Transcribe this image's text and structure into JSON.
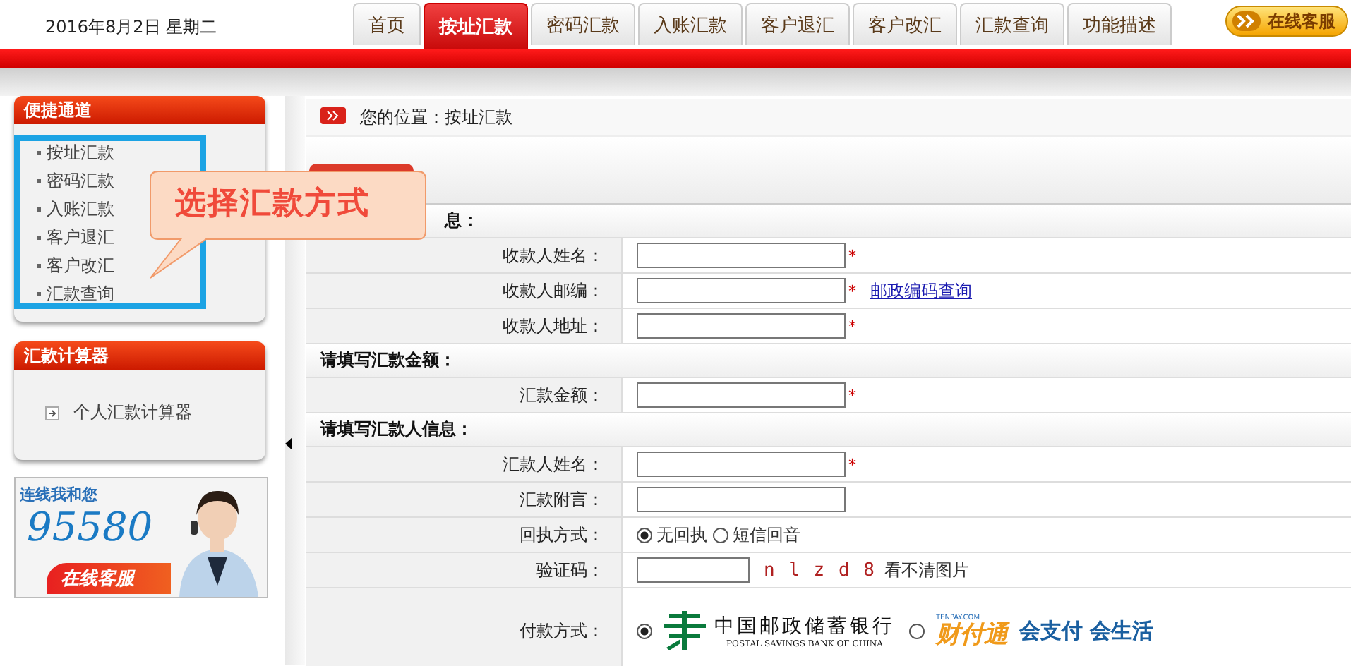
{
  "header": {
    "date": "2016年8月2日 星期二",
    "online_service": "在线客服"
  },
  "tabs": [
    {
      "label": "首页",
      "selected": false
    },
    {
      "label": "按址汇款",
      "selected": true
    },
    {
      "label": "密码汇款",
      "selected": false
    },
    {
      "label": "入账汇款",
      "selected": false
    },
    {
      "label": "客户退汇",
      "selected": false
    },
    {
      "label": "客户改汇",
      "selected": false
    },
    {
      "label": "汇款查询",
      "selected": false
    },
    {
      "label": "功能描述",
      "selected": false
    }
  ],
  "sidebar": {
    "quick_links": {
      "title": "便捷通道",
      "items": [
        "按址汇款",
        "密码汇款",
        "入账汇款",
        "客户退汇",
        "客户改汇",
        "汇款查询"
      ]
    },
    "calculator": {
      "title": "汇款计算器",
      "items": [
        "个人汇款计算器"
      ]
    },
    "banner": {
      "caption": "连线我和您",
      "phone": "95580",
      "button": "在线客服"
    }
  },
  "breadcrumb": "您的位置：按址汇款",
  "form": {
    "sections": [
      {
        "heading": "息：",
        "rows": [
          {
            "kind": "text",
            "label": "收款人姓名：",
            "required_mark": "*"
          },
          {
            "kind": "text",
            "label": "收款人邮编：",
            "required_mark": "*",
            "link": "邮政编码查询"
          },
          {
            "kind": "text",
            "label": "收款人地址：",
            "required_mark": "*"
          }
        ]
      },
      {
        "heading": "请填写汇款金额：",
        "rows": [
          {
            "kind": "text",
            "label": "汇款金额：",
            "required_mark": "*"
          }
        ]
      },
      {
        "heading": "请填写汇款人信息：",
        "rows": [
          {
            "kind": "text",
            "label": "汇款人姓名：",
            "required_mark": "*"
          },
          {
            "kind": "text",
            "label": "汇款附言："
          },
          {
            "kind": "radio",
            "label": "回执方式：",
            "options": [
              {
                "label": "无回执",
                "selected": true
              },
              {
                "label": "短信回音",
                "selected": false
              }
            ]
          },
          {
            "kind": "captcha",
            "label": "验证码：",
            "code": "n l z d 8",
            "hint": "看不清图片"
          },
          {
            "kind": "payment",
            "label": "付款方式：",
            "options": [
              {
                "kind": "psbc",
                "name": "中国邮政储蓄银行",
                "subname": "POSTAL SAVINGS BANK OF CHINA",
                "selected": true
              },
              {
                "kind": "tenpay",
                "domain": "TENPAY.COM",
                "name": "财付通",
                "slogan": "会支付 会生活",
                "selected": false
              }
            ]
          }
        ]
      }
    ]
  },
  "callout": "选择汇款方式"
}
